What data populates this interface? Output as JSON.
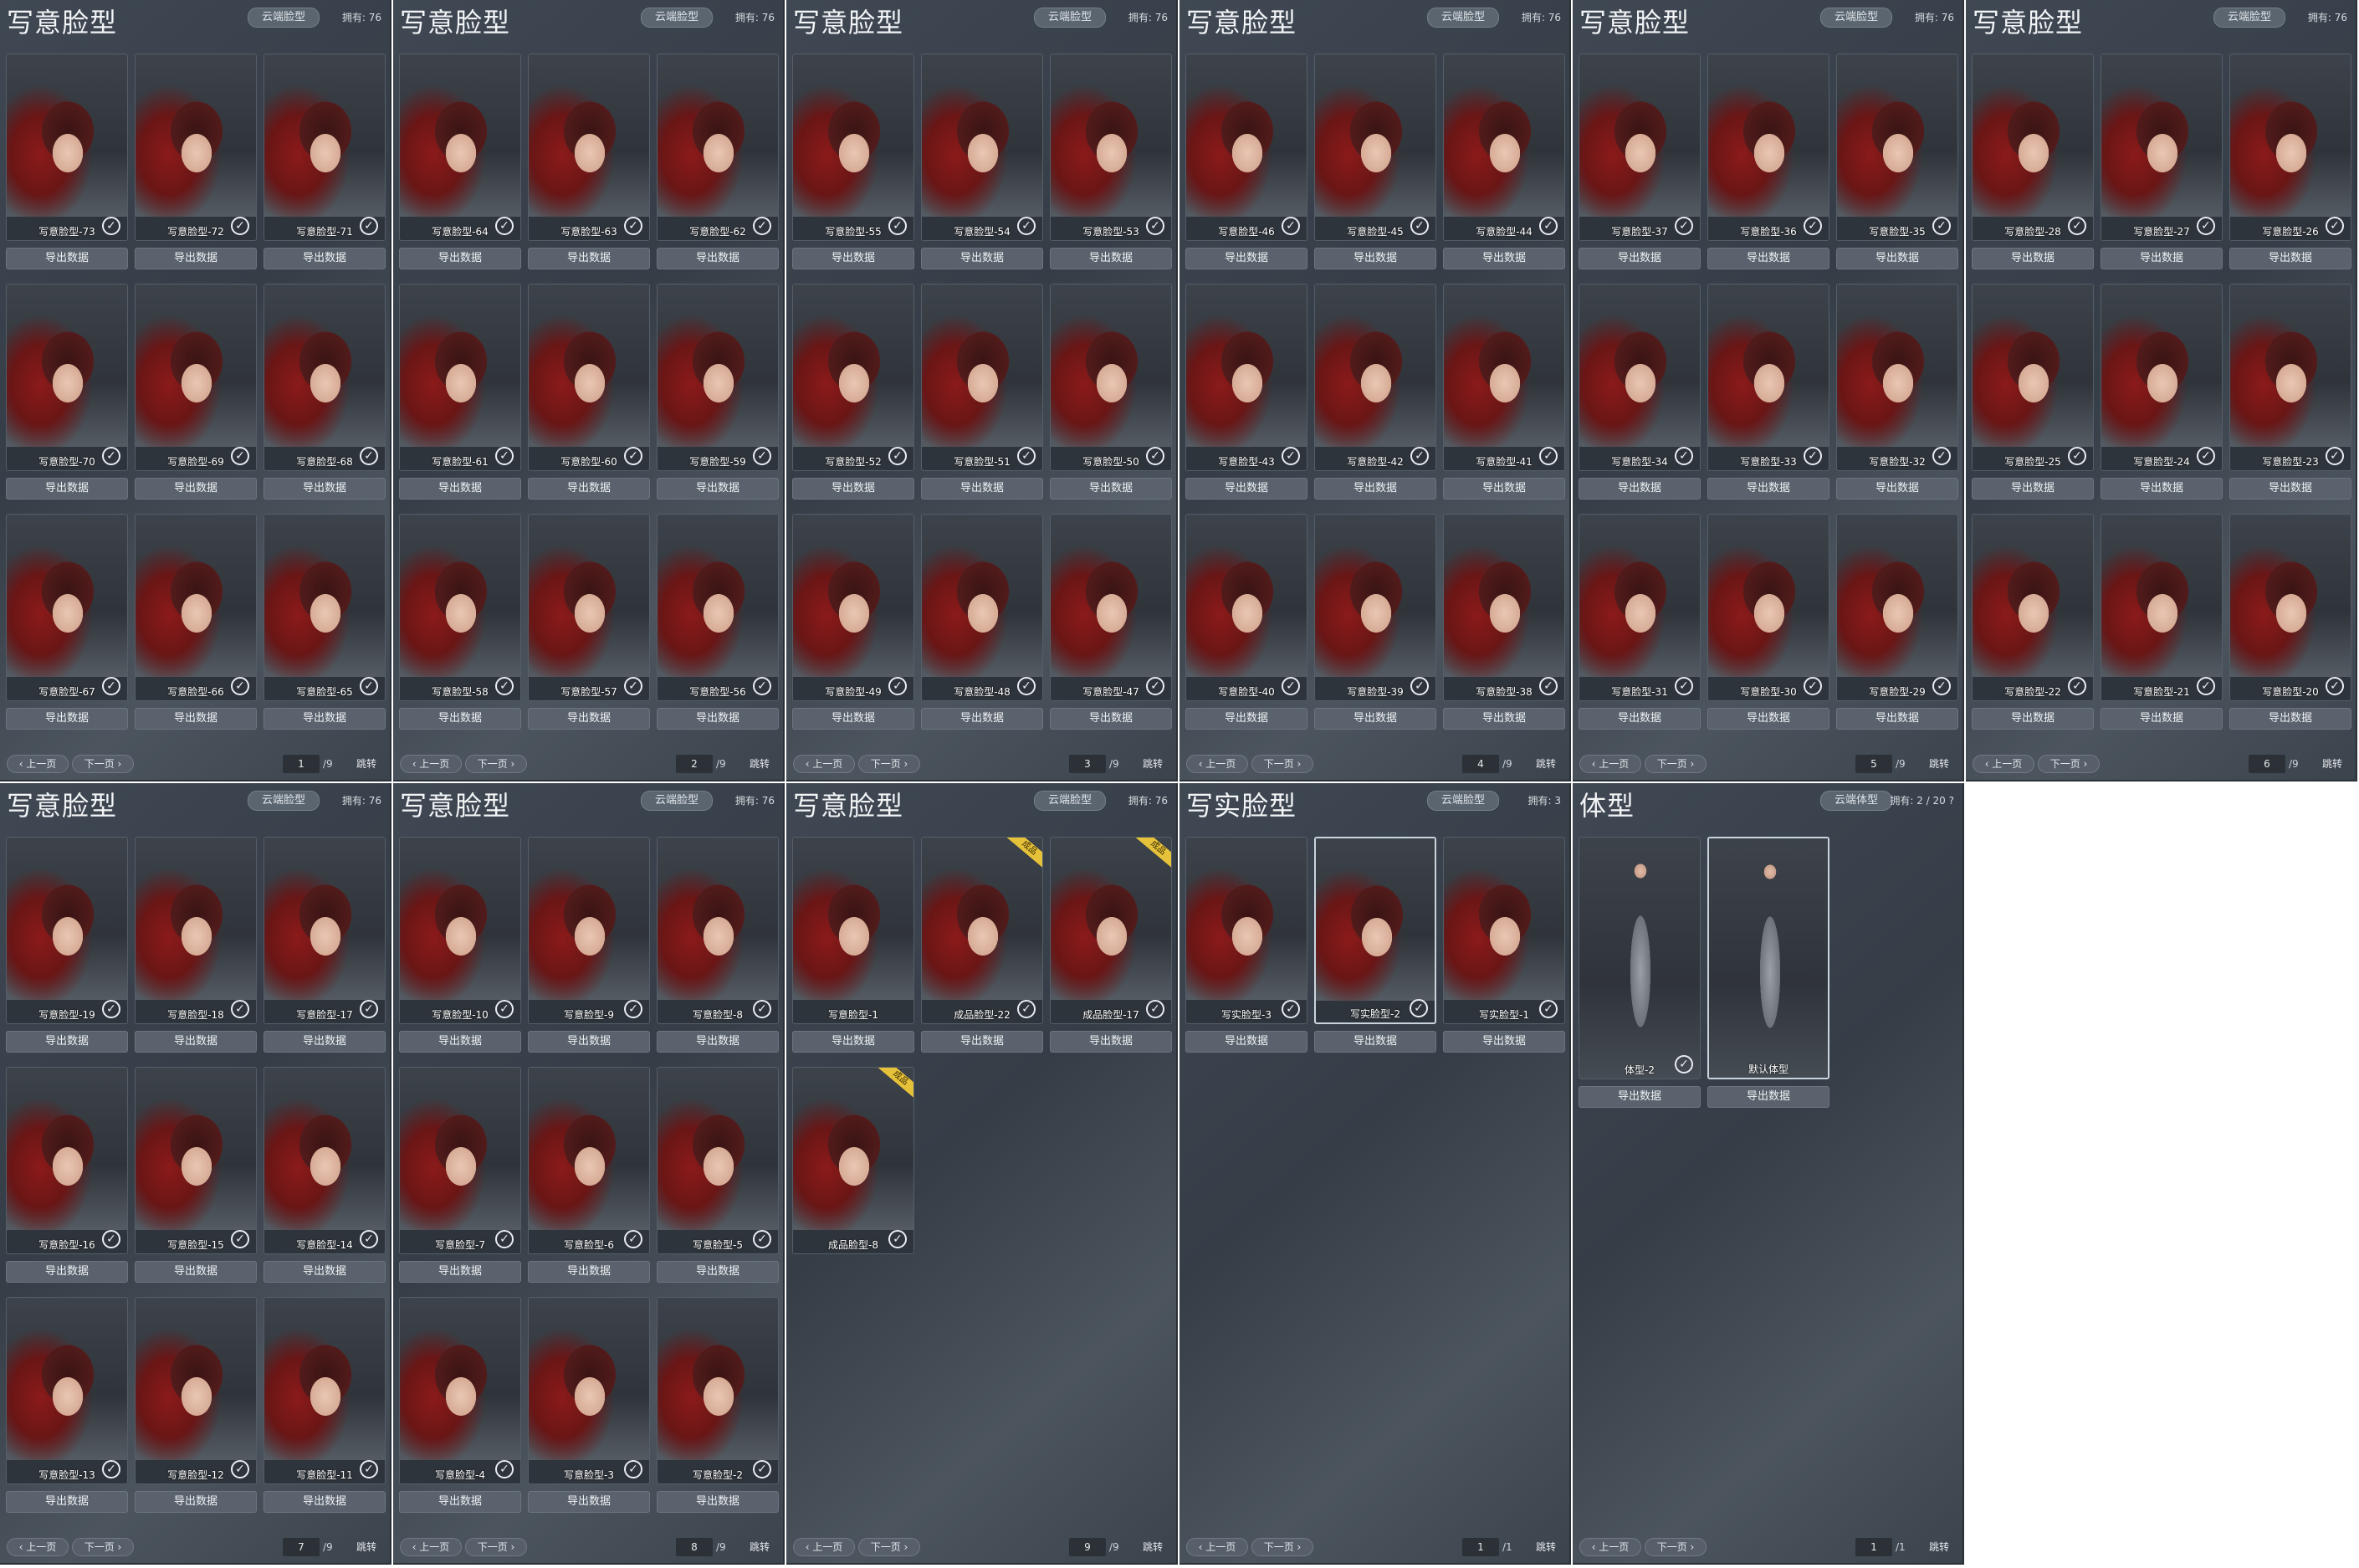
{
  "common": {
    "cloud_face": "云端脸型",
    "cloud_body": "云端体型",
    "export": "导出数据",
    "prev": "上一页",
    "next": "下一页",
    "jump": "跳转",
    "badge": "成品"
  },
  "panels": [
    {
      "title": "写意脸型",
      "cloud": "云端脸型",
      "owned": "拥有: 76",
      "page": "1",
      "total": "/9",
      "kind": "face",
      "items": [
        {
          "name": "写意脸型-73"
        },
        {
          "name": "写意脸型-72"
        },
        {
          "name": "写意脸型-71"
        },
        {
          "name": "写意脸型-70"
        },
        {
          "name": "写意脸型-69"
        },
        {
          "name": "写意脸型-68"
        },
        {
          "name": "写意脸型-67"
        },
        {
          "name": "写意脸型-66"
        },
        {
          "name": "写意脸型-65"
        }
      ]
    },
    {
      "title": "写意脸型",
      "cloud": "云端脸型",
      "owned": "拥有: 76",
      "page": "2",
      "total": "/9",
      "kind": "face",
      "items": [
        {
          "name": "写意脸型-64"
        },
        {
          "name": "写意脸型-63"
        },
        {
          "name": "写意脸型-62"
        },
        {
          "name": "写意脸型-61"
        },
        {
          "name": "写意脸型-60"
        },
        {
          "name": "写意脸型-59"
        },
        {
          "name": "写意脸型-58"
        },
        {
          "name": "写意脸型-57"
        },
        {
          "name": "写意脸型-56"
        }
      ]
    },
    {
      "title": "写意脸型",
      "cloud": "云端脸型",
      "owned": "拥有: 76",
      "page": "3",
      "total": "/9",
      "kind": "face",
      "items": [
        {
          "name": "写意脸型-55"
        },
        {
          "name": "写意脸型-54"
        },
        {
          "name": "写意脸型-53"
        },
        {
          "name": "写意脸型-52"
        },
        {
          "name": "写意脸型-51"
        },
        {
          "name": "写意脸型-50"
        },
        {
          "name": "写意脸型-49"
        },
        {
          "name": "写意脸型-48"
        },
        {
          "name": "写意脸型-47"
        }
      ]
    },
    {
      "title": "写意脸型",
      "cloud": "云端脸型",
      "owned": "拥有: 76",
      "page": "4",
      "total": "/9",
      "kind": "face",
      "items": [
        {
          "name": "写意脸型-46"
        },
        {
          "name": "写意脸型-45"
        },
        {
          "name": "写意脸型-44"
        },
        {
          "name": "写意脸型-43"
        },
        {
          "name": "写意脸型-42"
        },
        {
          "name": "写意脸型-41"
        },
        {
          "name": "写意脸型-40"
        },
        {
          "name": "写意脸型-39"
        },
        {
          "name": "写意脸型-38"
        }
      ]
    },
    {
      "title": "写意脸型",
      "cloud": "云端脸型",
      "owned": "拥有: 76",
      "page": "5",
      "total": "/9",
      "kind": "face",
      "items": [
        {
          "name": "写意脸型-37"
        },
        {
          "name": "写意脸型-36"
        },
        {
          "name": "写意脸型-35"
        },
        {
          "name": "写意脸型-34"
        },
        {
          "name": "写意脸型-33"
        },
        {
          "name": "写意脸型-32"
        },
        {
          "name": "写意脸型-31"
        },
        {
          "name": "写意脸型-30"
        },
        {
          "name": "写意脸型-29"
        }
      ]
    },
    {
      "title": "写意脸型",
      "cloud": "云端脸型",
      "owned": "拥有: 76",
      "page": "6",
      "total": "/9",
      "kind": "face",
      "items": [
        {
          "name": "写意脸型-28"
        },
        {
          "name": "写意脸型-27"
        },
        {
          "name": "写意脸型-26"
        },
        {
          "name": "写意脸型-25"
        },
        {
          "name": "写意脸型-24"
        },
        {
          "name": "写意脸型-23"
        },
        {
          "name": "写意脸型-22"
        },
        {
          "name": "写意脸型-21"
        },
        {
          "name": "写意脸型-20"
        }
      ]
    },
    {
      "title": "写意脸型",
      "cloud": "云端脸型",
      "owned": "拥有: 76",
      "page": "7",
      "total": "/9",
      "kind": "face",
      "items": [
        {
          "name": "写意脸型-19"
        },
        {
          "name": "写意脸型-18"
        },
        {
          "name": "写意脸型-17"
        },
        {
          "name": "写意脸型-16"
        },
        {
          "name": "写意脸型-15"
        },
        {
          "name": "写意脸型-14"
        },
        {
          "name": "写意脸型-13"
        },
        {
          "name": "写意脸型-12"
        },
        {
          "name": "写意脸型-11"
        }
      ]
    },
    {
      "title": "写意脸型",
      "cloud": "云端脸型",
      "owned": "拥有: 76",
      "page": "8",
      "total": "/9",
      "kind": "face",
      "items": [
        {
          "name": "写意脸型-10"
        },
        {
          "name": "写意脸型-9"
        },
        {
          "name": "写意脸型-8"
        },
        {
          "name": "写意脸型-7"
        },
        {
          "name": "写意脸型-6"
        },
        {
          "name": "写意脸型-5"
        },
        {
          "name": "写意脸型-4"
        },
        {
          "name": "写意脸型-3"
        },
        {
          "name": "写意脸型-2"
        }
      ]
    },
    {
      "title": "写意脸型",
      "cloud": "云端脸型",
      "owned": "拥有: 76",
      "page": "9",
      "total": "/9",
      "kind": "face",
      "items": [
        {
          "name": "写意脸型-1",
          "check": false
        },
        {
          "name": "成品脸型-22",
          "badge": true
        },
        {
          "name": "成品脸型-17",
          "badge": true
        },
        {
          "name": "成品脸型-8",
          "badge": true,
          "noexport": true
        }
      ]
    },
    {
      "title": "写实脸型",
      "cloud": "云端脸型",
      "owned": "拥有: 3",
      "page": "1",
      "total": "/1",
      "kind": "face",
      "items": [
        {
          "name": "写实脸型-3"
        },
        {
          "name": "写实脸型-2",
          "selected": true
        },
        {
          "name": "写实脸型-1"
        }
      ]
    },
    {
      "title": "体型",
      "cloud": "云端体型",
      "owned": "拥有: 2 / 20 ?",
      "page": "1",
      "total": "/1",
      "kind": "body",
      "items": [
        {
          "name": "体型-2"
        },
        {
          "name": "默认体型",
          "selected": true,
          "check": false
        }
      ]
    }
  ]
}
